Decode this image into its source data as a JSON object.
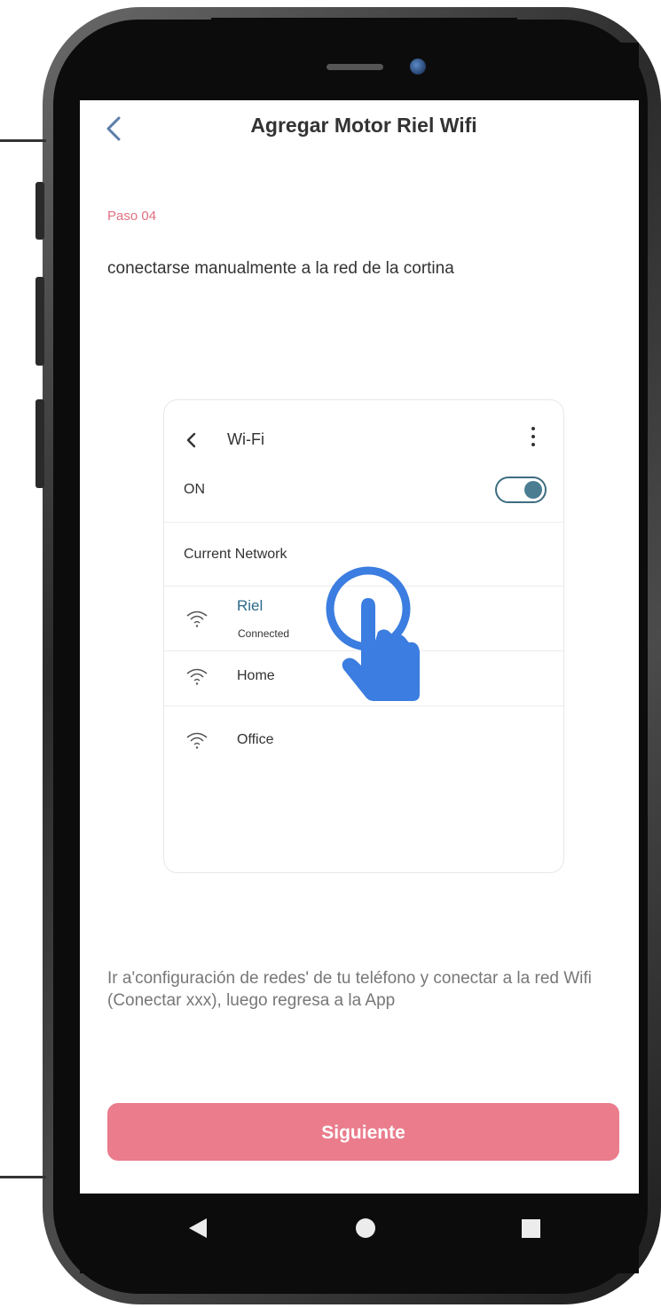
{
  "header": {
    "title": "Agregar Motor Riel Wifi",
    "back_icon": "chevron-left-icon"
  },
  "step": {
    "label": "Paso 04",
    "instruction": "conectarse manualmente a la red de la cortina"
  },
  "illustration": {
    "title": "Wi-Fi",
    "toggle_label": "ON",
    "toggle_on": true,
    "section_label": "Current Network",
    "networks": [
      {
        "name": "Riel",
        "status": "Connected",
        "icon": "wifi-icon"
      },
      {
        "name": "Home",
        "icon": "wifi-icon"
      },
      {
        "name": "Office",
        "icon": "wifi-icon"
      }
    ]
  },
  "help_text": "Ir a'configuración de redes' de tu teléfono y conectar a la red Wifi (Conectar xxx), luego regresa a la App",
  "next_button": {
    "label": "Siguiente"
  },
  "colors": {
    "accent": "#ea7c8c",
    "step": "#e07080",
    "toggle": "#4a7d92",
    "hand": "#3b7de0"
  },
  "system_nav": [
    "back-icon",
    "home-icon",
    "recents-icon"
  ]
}
